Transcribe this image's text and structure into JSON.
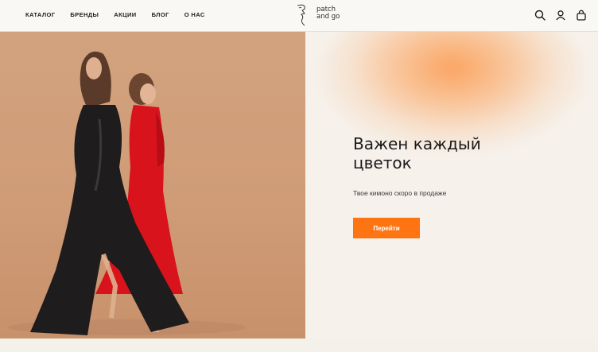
{
  "header": {
    "nav": [
      "КАТАЛОГ",
      "БРЕНДЫ",
      "АКЦИИ",
      "БЛОГ",
      "О НАС"
    ],
    "logo": {
      "line1": "patch",
      "line2": "and go"
    },
    "icons": [
      "search-icon",
      "account-icon",
      "cart-icon"
    ]
  },
  "hero": {
    "title": "Важен каждый цветок",
    "subtitle": "Твое кимоно скоро в продаже",
    "button_label": "Перейти"
  },
  "colors": {
    "accent": "#ff7412",
    "hero_image_bg": "#d0a07b",
    "page_bg": "#f5f1eb",
    "text": "#1a1a1a"
  }
}
